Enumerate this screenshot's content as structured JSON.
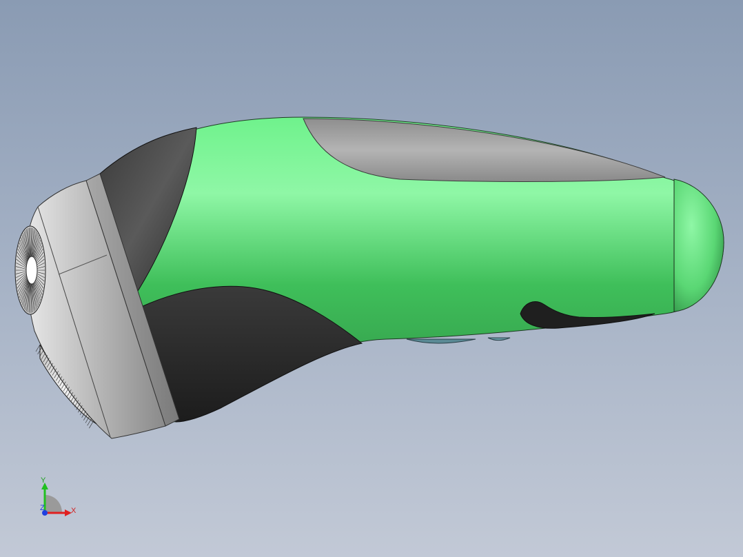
{
  "viewport": {
    "background_top": "#8a9bb3",
    "background_bottom": "#c2c9d6"
  },
  "model": {
    "colors": {
      "body_green": "#4cd466",
      "grip_dark": "#2a2a2a",
      "cover_gray": "#9c9c9c",
      "head_silver": "#c8c8c8",
      "foil_white": "#f2f2f2"
    }
  },
  "triad": {
    "x_label": "X",
    "y_label": "Y",
    "z_label": "Z",
    "x_color": "#e02020",
    "y_color": "#20c020",
    "z_color": "#2040e0"
  }
}
